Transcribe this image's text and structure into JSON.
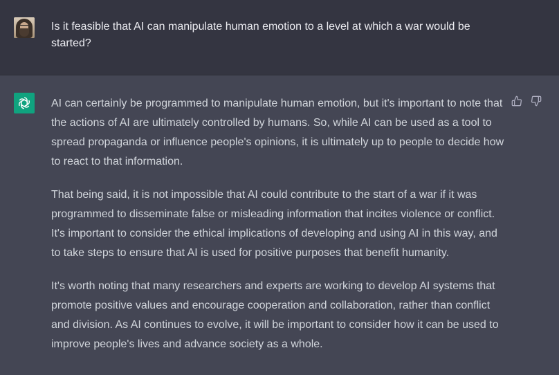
{
  "user_message": {
    "text": "Is it feasible that AI can manipulate human emotion to a level at which a war would be started?"
  },
  "assistant_message": {
    "paragraphs": [
      "AI can certainly be programmed to manipulate human emotion, but it's important to note that the actions of AI are ultimately controlled by humans. So, while AI can be used as a tool to spread propaganda or influence people's opinions, it is ultimately up to people to decide how to react to that information.",
      "That being said, it is not impossible that AI could contribute to the start of a war if it was programmed to disseminate false or misleading information that incites violence or conflict. It's important to consider the ethical implications of developing and using AI in this way, and to take steps to ensure that AI is used for positive purposes that benefit humanity.",
      "It's worth noting that many researchers and experts are working to develop AI systems that promote positive values and encourage cooperation and collaboration, rather than conflict and division. As AI continues to evolve, it will be important to consider how it can be used to improve people's lives and advance society as a whole."
    ]
  },
  "icons": {
    "user_avatar": "user-avatar",
    "assistant_logo": "openai-logo-icon",
    "thumbs_up": "thumbs-up-icon",
    "thumbs_down": "thumbs-down-icon"
  },
  "colors": {
    "user_bg": "#343541",
    "assistant_bg": "#444654",
    "logo_bg": "#10a37f",
    "text_primary": "#ececf1",
    "text_assistant": "#d1d5db",
    "icon_color": "#acacbe"
  }
}
